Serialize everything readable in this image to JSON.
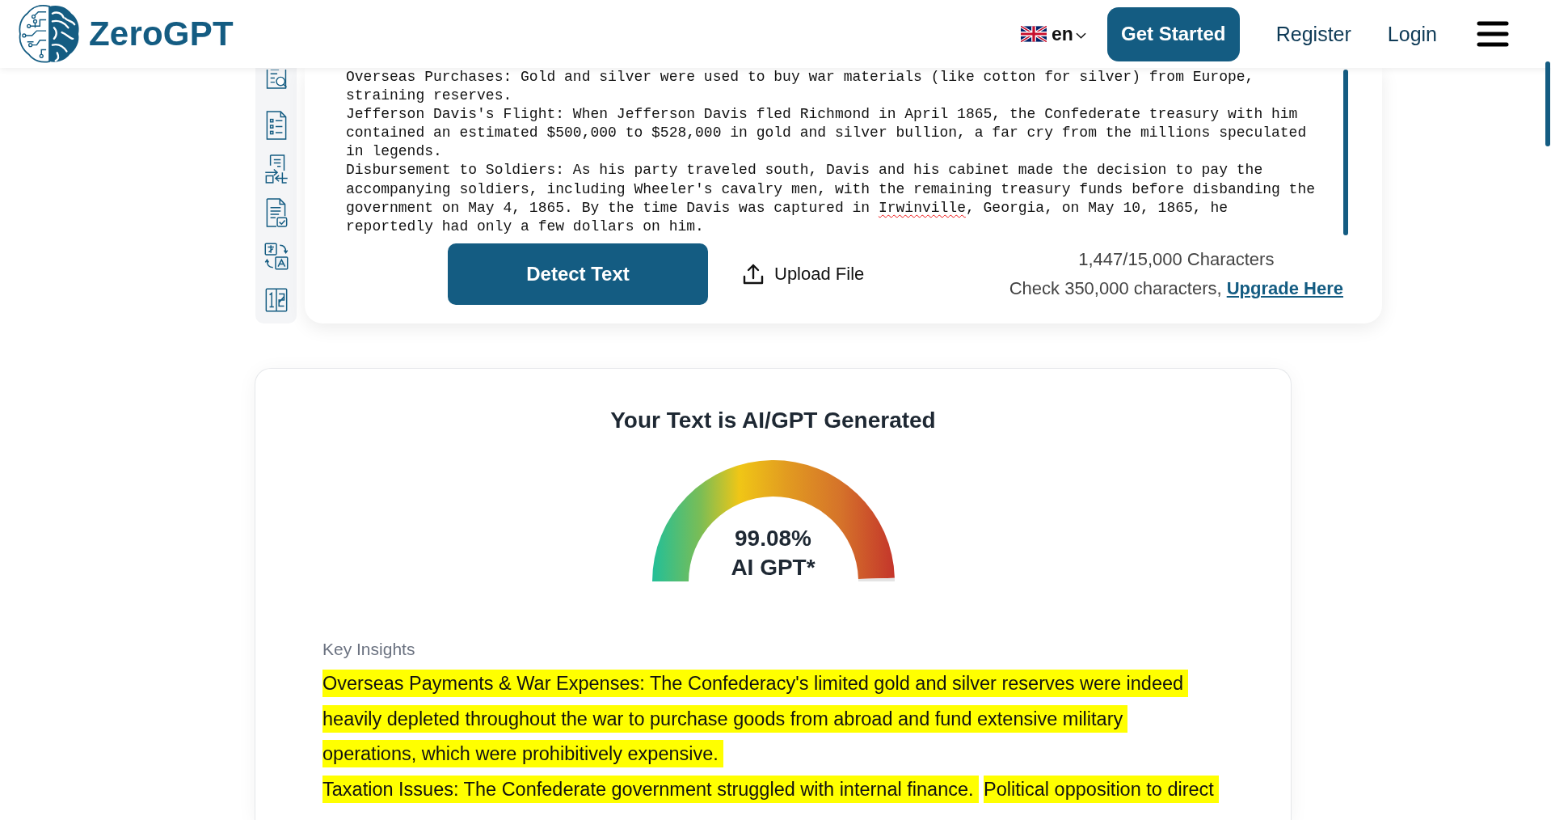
{
  "header": {
    "logo_text": "ZeroGPT",
    "language": "en",
    "cta": "Get Started",
    "links": [
      "Register",
      "Login"
    ]
  },
  "editor": {
    "paragraphs": [
      {
        "segments": [
          {
            "text": "Overseas Purchases: Gold and silver were used to buy war materials (like cotton for silver) from Europe, straining reserves.",
            "misspelled": false
          }
        ]
      },
      {
        "segments": [
          {
            "text": "Jefferson Davis's Flight: When Jefferson Davis fled Richmond in April 1865, the Confederate treasury with him contained an estimated $500,000 to $528,000 in gold and silver bullion, a far cry from the millions speculated in legends.",
            "misspelled": false
          }
        ]
      },
      {
        "segments": [
          {
            "text": "Disbursement to Soldiers: As his party traveled south, Davis and his cabinet made the decision to pay the accompanying soldiers, including Wheeler's cavalry men, with the remaining treasury funds before disbanding the government on May 4, 1865. By the time Davis was captured in ",
            "misspelled": false
          },
          {
            "text": "Irwinville",
            "misspelled": true
          },
          {
            "text": ", Georgia, on May 10, 1865, he reportedly had only a few dollars on him.",
            "misspelled": false
          }
        ]
      }
    ],
    "detect_button": "Detect Text",
    "upload_button": "Upload File",
    "char_count": "1,447/15,000 Characters",
    "upgrade_note": "Check 350,000 characters,",
    "upgrade_link": "Upgrade Here"
  },
  "result": {
    "title": "Your Text is AI/GPT Generated",
    "gauge": {
      "level": 0.9908,
      "value": "99.08%",
      "label": "AI GPT*"
    },
    "insights_heading": "Key Insights",
    "insight_lines": [
      {
        "segments": [
          {
            "text": "Overseas Payments & War Expenses: The Confederacy's limited gold and silver reserves were indeed",
            "highlighted": true
          }
        ]
      },
      {
        "segments": [
          {
            "text": "heavily depleted throughout the war to purchase goods from abroad and fund extensive military",
            "highlighted": true
          }
        ]
      },
      {
        "segments": [
          {
            "text": "operations, which were prohibitively expensive.",
            "highlighted": true
          }
        ]
      },
      {
        "segments": [
          {
            "text": "Taxation Issues: The Confederate government struggled with internal finance.",
            "highlighted": true
          },
          {
            "text": "Political opposition to direct",
            "highlighted": true
          }
        ]
      }
    ]
  }
}
